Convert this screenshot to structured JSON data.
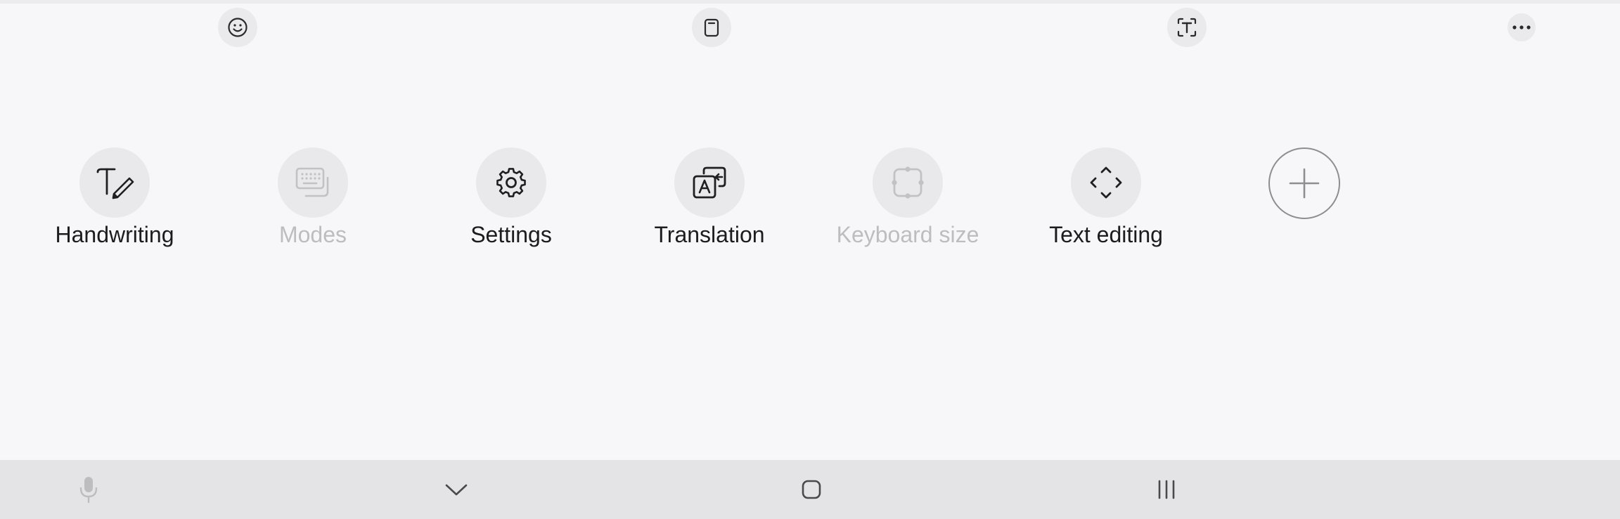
{
  "toolbar": {
    "icons": [
      "emoji-icon",
      "clipboard-icon",
      "text-extract-icon",
      "more-options-icon"
    ]
  },
  "tiles": [
    {
      "label": "Handwriting",
      "icon": "handwriting-icon",
      "enabled": true
    },
    {
      "label": "Modes",
      "icon": "keyboard-modes-icon",
      "enabled": false
    },
    {
      "label": "Settings",
      "icon": "gear-icon",
      "enabled": true
    },
    {
      "label": "Translation",
      "icon": "translate-icon",
      "enabled": true
    },
    {
      "label": "Keyboard size",
      "icon": "resize-icon",
      "enabled": false
    },
    {
      "label": "Text editing",
      "icon": "text-editing-icon",
      "enabled": true
    }
  ],
  "add_button": {
    "icon": "plus-icon"
  },
  "navbar": {
    "icons": [
      "microphone-icon",
      "chevron-down-icon",
      "home-icon",
      "recent-apps-icon"
    ]
  },
  "colors": {
    "background": "#f7f7f9",
    "tile_circle": "#e9e9eb",
    "enabled_text": "#1c1c1e",
    "disabled_text": "#bdbdc1",
    "navbar": "#e4e4e6"
  }
}
